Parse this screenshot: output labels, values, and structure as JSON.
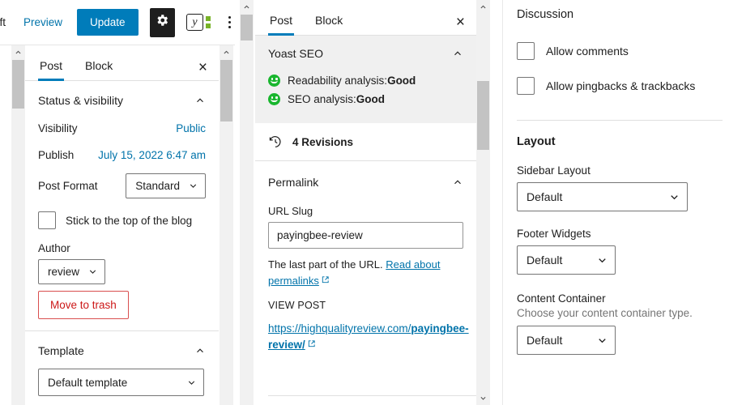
{
  "toolbar": {
    "save_draft_label": "aft",
    "preview_label": "Preview",
    "update_label": "Update",
    "gear_icon": "gear-icon",
    "yoast_icon": "yoast-logo-icon",
    "yoast_letter": "y",
    "more_icon": "more-options-icon"
  },
  "panel_post": {
    "tabs": [
      {
        "label": "Post",
        "active": true
      },
      {
        "label": "Block",
        "active": false
      }
    ],
    "close_label": "×",
    "status_section": {
      "title": "Status & visibility",
      "rows": [
        {
          "label": "Visibility",
          "value": "Public"
        },
        {
          "label": "Publish",
          "value": "July 15, 2022 6:47 am"
        }
      ],
      "post_format_label": "Post Format",
      "post_format_value": "Standard",
      "sticky_label": "Stick to the top of the blog",
      "sticky_checked": false,
      "author_label": "Author",
      "author_value": "review",
      "trash_label": "Move to trash"
    },
    "template_section": {
      "title": "Template",
      "value": "Default template"
    }
  },
  "panel_middle": {
    "tabs": [
      {
        "label": "Post",
        "active": true
      },
      {
        "label": "Block",
        "active": false
      }
    ],
    "close_label": "×",
    "yoast": {
      "title": "Yoast SEO",
      "readability_prefix": "Readability analysis: ",
      "readability_value": "Good",
      "seo_prefix": "SEO analysis: ",
      "seo_value": "Good"
    },
    "revisions": {
      "icon": "revision-history-icon",
      "count_label": "4 Revisions"
    },
    "permalink": {
      "title": "Permalink",
      "slug_label": "URL Slug",
      "slug_value": "payingbee-review",
      "help_prefix": "The last part of the URL. ",
      "help_link": "Read about permalinks",
      "view_post_label": "VIEW POST",
      "url_base": "https://highqualityreview.com/",
      "url_slug": "payingbee-review/"
    }
  },
  "panel_right": {
    "discussion": {
      "title": "Discussion",
      "allow_comments_label": "Allow comments",
      "allow_comments_checked": false,
      "allow_pingbacks_label": "Allow pingbacks & trackbacks",
      "allow_pingbacks_checked": false
    },
    "layout": {
      "title": "Layout",
      "sidebar_layout_label": "Sidebar Layout",
      "sidebar_layout_value": "Default",
      "footer_widgets_label": "Footer Widgets",
      "footer_widgets_value": "Default",
      "content_container_label": "Content Container",
      "content_container_help": "Choose your content container type.",
      "content_container_value": "Default"
    }
  },
  "colors": {
    "accent_blue": "#007cba",
    "link_blue": "#0073aa",
    "danger_red": "#cc1818",
    "good_green": "#19b62e",
    "yoast_green": "#77b227"
  }
}
